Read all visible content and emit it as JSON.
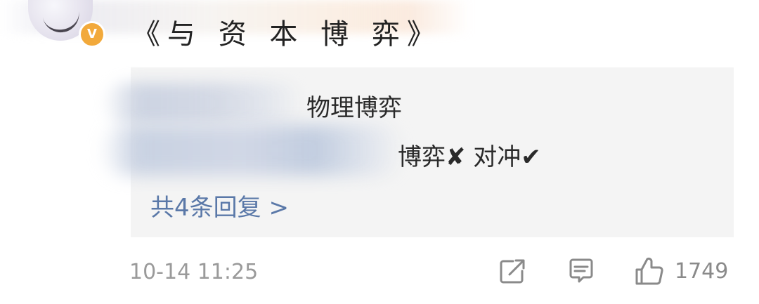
{
  "post": {
    "title": "《与 资 本 博 弈》",
    "verified_badge": "V"
  },
  "replies": {
    "line_1": "物理博弈",
    "line_2": "博弈✘ 对冲✔",
    "more_replies": "共4条回复 >"
  },
  "meta": {
    "time": "10-14 11:25",
    "like_count": "1749"
  },
  "icons": {
    "share": "share-icon",
    "comment": "comment-icon",
    "like": "thumbs-up-icon"
  },
  "colors": {
    "link": "#5a78a8",
    "badge": "#f2a93b"
  }
}
